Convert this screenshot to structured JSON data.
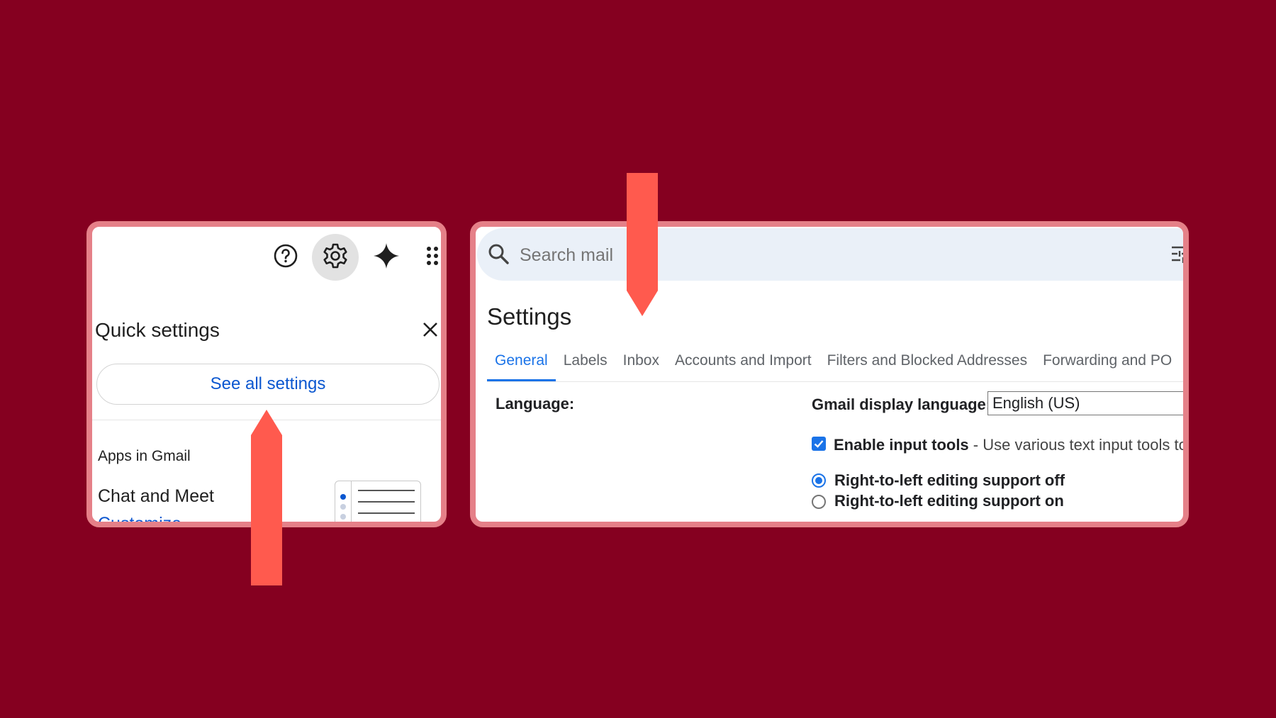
{
  "quick_settings": {
    "title": "Quick settings",
    "see_all_label": "See all settings",
    "apps_label": "Apps in Gmail",
    "chat_label": "Chat and Meet",
    "customize_label": "Customize"
  },
  "topbar": {
    "icons": [
      "help-icon",
      "gear-icon",
      "gemini-sparkle-icon",
      "apps-grid-icon"
    ]
  },
  "search": {
    "placeholder": "Search mail"
  },
  "settings": {
    "title": "Settings",
    "tabs": [
      "General",
      "Labels",
      "Inbox",
      "Accounts and Import",
      "Filters and Blocked Addresses",
      "Forwarding and PO"
    ],
    "active_tab": "General",
    "language_label": "Language:",
    "display_language_label": "Gmail display language:",
    "display_language_value": "English (US)",
    "enable_input_label": "Enable input tools",
    "enable_input_desc": "- Use various text input tools to typ",
    "rtl_off_label": "Right-to-left editing support off",
    "rtl_on_label": "Right-to-left editing support on"
  },
  "colors": {
    "background": "#850020",
    "card_border": "#e58088",
    "arrow": "#ff5a4e",
    "accent": "#1a73e8"
  }
}
